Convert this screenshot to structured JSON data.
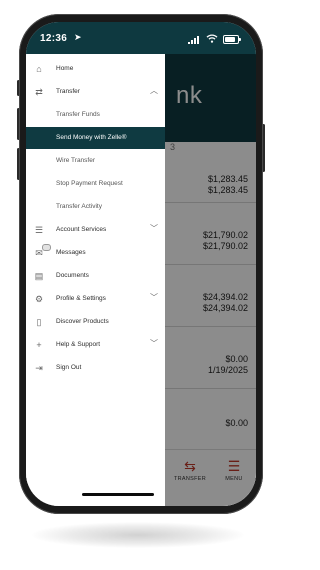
{
  "status": {
    "time": "12:36",
    "location_icon": "location-arrow-icon",
    "signal_icon": "signal-icon",
    "wifi_icon": "wifi-icon",
    "battery_icon": "battery-icon"
  },
  "brand": {
    "partial_text": "nk"
  },
  "accounts": [
    {
      "suffix": "3",
      "line1": "$1,283.45",
      "line2": "$1,283.45"
    },
    {
      "line1": "$21,790.02",
      "line2": "$21,790.02"
    },
    {
      "line1": "$24,394.02",
      "line2": "$24,394.02"
    },
    {
      "line1": "$0.00",
      "line2": "1/19/2025"
    },
    {
      "line1": "$0.00"
    }
  ],
  "tabbar": {
    "transfer": {
      "label": "TRANSFER",
      "icon": "transfer-arrows-icon"
    },
    "menu": {
      "label": "MENU",
      "icon": "menu-list-icon"
    }
  },
  "menu": {
    "home": {
      "label": "Home",
      "icon": "home-icon"
    },
    "transfer": {
      "label": "Transfer",
      "icon": "transfer-arrows-icon",
      "expanded": true
    },
    "transfer_funds": {
      "label": "Transfer Funds"
    },
    "send_money_zelle": {
      "label": "Send Money with Zelle®",
      "active": true
    },
    "wire_transfer": {
      "label": "Wire Transfer"
    },
    "stop_payment": {
      "label": "Stop Payment Request"
    },
    "transfer_activity": {
      "label": "Transfer Activity"
    },
    "account_services": {
      "label": "Account Services",
      "icon": "list-icon"
    },
    "messages": {
      "label": "Messages",
      "icon": "mail-icon"
    },
    "documents": {
      "label": "Documents",
      "icon": "document-icon"
    },
    "profile_settings": {
      "label": "Profile & Settings",
      "icon": "gear-icon"
    },
    "discover_products": {
      "label": "Discover Products",
      "icon": "phone-icon"
    },
    "help_support": {
      "label": "Help & Support",
      "icon": "plus-icon"
    },
    "sign_out": {
      "label": "Sign Out",
      "icon": "sign-out-icon"
    }
  },
  "colors": {
    "header": "#0f3a41",
    "active_item": "#0f3a41",
    "tab_icon": "#c0392b"
  }
}
